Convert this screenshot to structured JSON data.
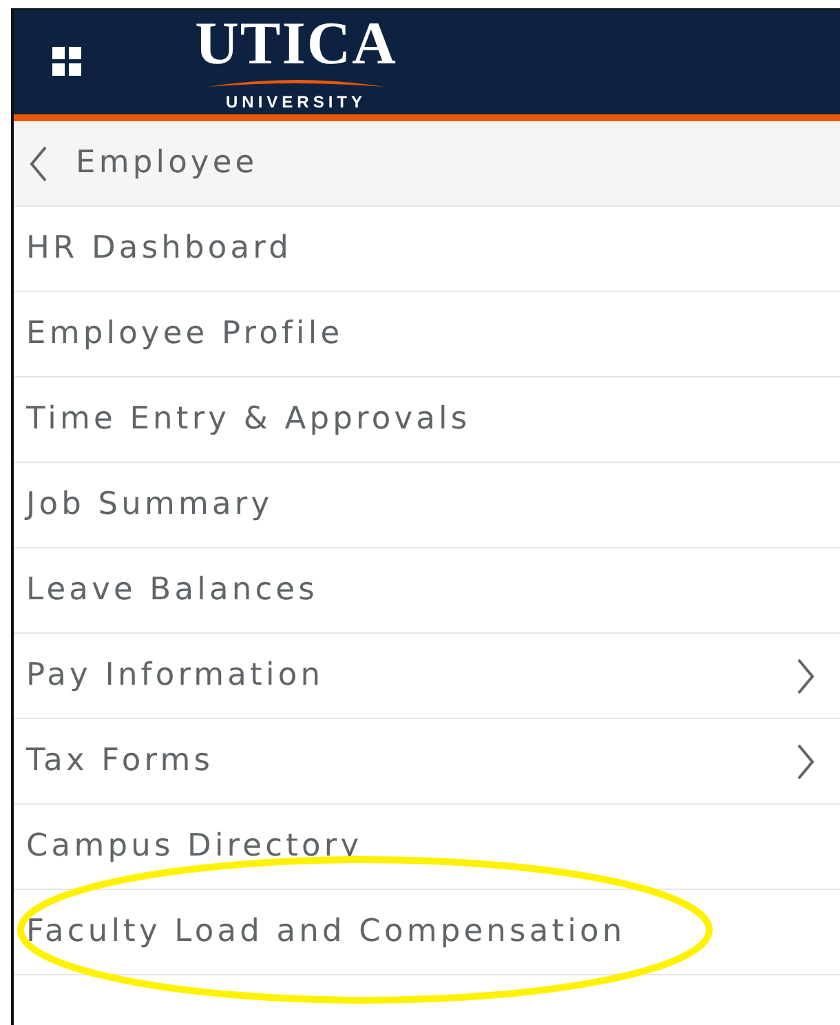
{
  "header": {
    "logo_title": "UTICA",
    "logo_subtitle": "UNIVERSITY"
  },
  "back": {
    "label": "Employee"
  },
  "menu": [
    {
      "label": "HR Dashboard",
      "submenu": false,
      "highlighted": false
    },
    {
      "label": "Employee Profile",
      "submenu": false,
      "highlighted": false
    },
    {
      "label": "Time Entry & Approvals",
      "submenu": false,
      "highlighted": false
    },
    {
      "label": "Job Summary",
      "submenu": false,
      "highlighted": false
    },
    {
      "label": "Leave Balances",
      "submenu": false,
      "highlighted": false
    },
    {
      "label": "Pay Information",
      "submenu": true,
      "highlighted": false
    },
    {
      "label": "Tax Forms",
      "submenu": true,
      "highlighted": false
    },
    {
      "label": "Campus Directory",
      "submenu": false,
      "highlighted": false
    },
    {
      "label": "Faculty Load and Compensation",
      "submenu": false,
      "highlighted": true
    }
  ]
}
